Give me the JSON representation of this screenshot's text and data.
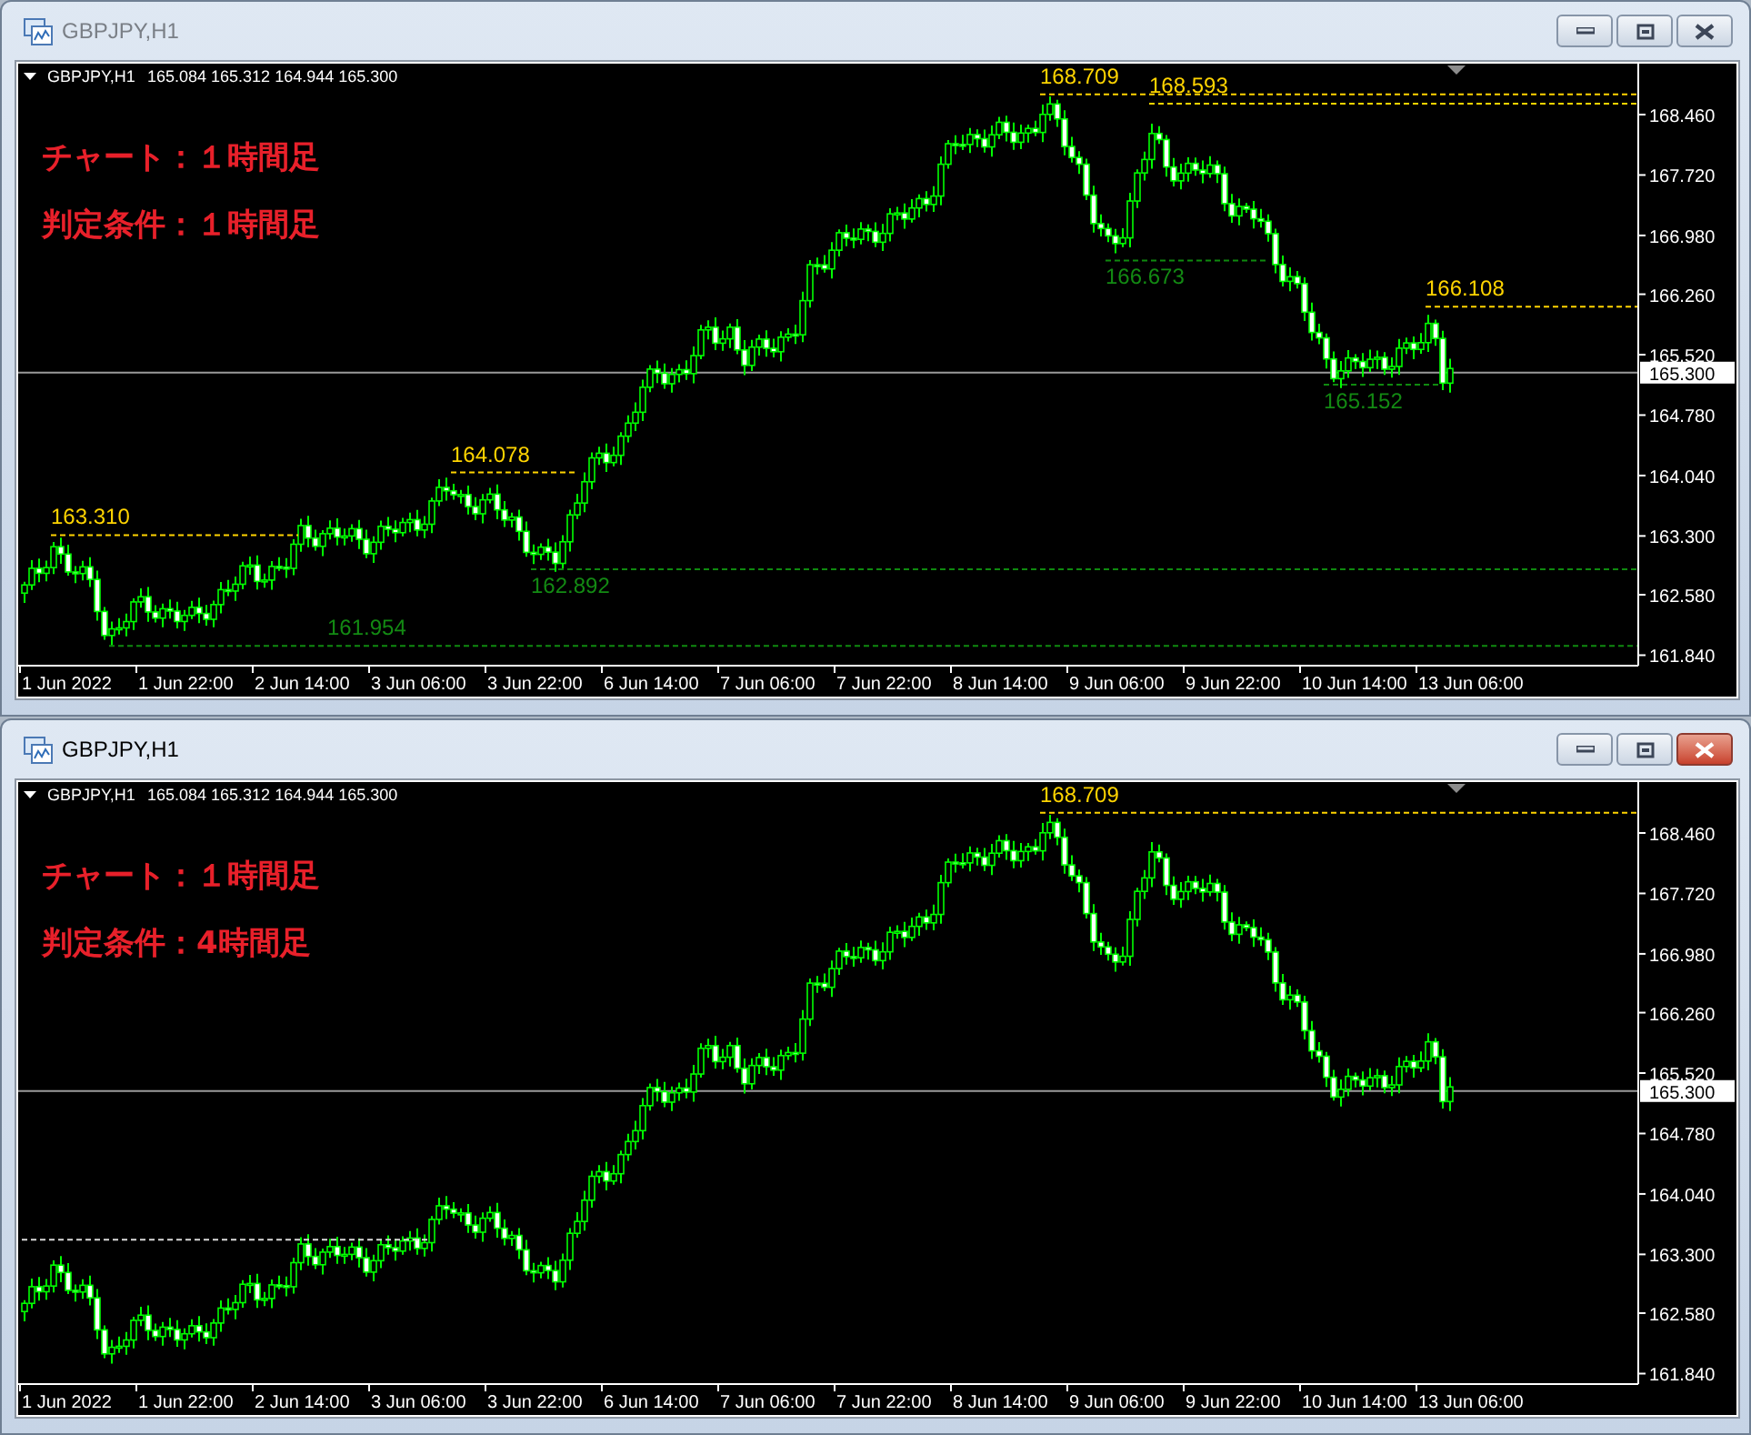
{
  "windows": [
    {
      "title": "GBPJPY,H1",
      "active": false,
      "chart": {
        "symbol": "GBPJPY,H1",
        "quote": "165.084 165.312 164.944 165.300",
        "notes": [
          "チャート：１時間足",
          "判定条件：１時間足"
        ],
        "price_axis": [
          "168.460",
          "167.720",
          "166.980",
          "166.260",
          "165.520",
          "164.780",
          "164.040",
          "163.300",
          "162.580",
          "161.840"
        ],
        "time_axis": [
          "1 Jun 2022",
          "1 Jun 22:00",
          "2 Jun 14:00",
          "3 Jun 06:00",
          "3 Jun 22:00",
          "6 Jun 14:00",
          "7 Jun 06:00",
          "7 Jun 22:00",
          "8 Jun 14:00",
          "9 Jun 06:00",
          "9 Jun 22:00",
          "10 Jun 14:00",
          "13 Jun 06:00"
        ],
        "current_price": "165.300",
        "levels": [
          {
            "kind": "high",
            "label": "168.709"
          },
          {
            "kind": "high",
            "label": "168.593"
          },
          {
            "kind": "low",
            "label": "166.673"
          },
          {
            "kind": "high",
            "label": "166.108"
          },
          {
            "kind": "low",
            "label": "165.152"
          },
          {
            "kind": "high",
            "label": "164.078"
          },
          {
            "kind": "high",
            "label": "163.310"
          },
          {
            "kind": "low",
            "label": "162.892"
          },
          {
            "kind": "low",
            "label": "161.954"
          }
        ]
      }
    },
    {
      "title": "GBPJPY,H1",
      "active": true,
      "chart": {
        "symbol": "GBPJPY,H1",
        "quote": "165.084 165.312 164.944 165.300",
        "notes": [
          "チャート：１時間足",
          "判定条件：4時間足"
        ],
        "price_axis": [
          "168.460",
          "167.720",
          "166.980",
          "166.260",
          "165.520",
          "164.780",
          "164.040",
          "163.300",
          "162.580",
          "161.840"
        ],
        "time_axis": [
          "1 Jun 2022",
          "1 Jun 22:00",
          "2 Jun 14:00",
          "3 Jun 06:00",
          "3 Jun 22:00",
          "6 Jun 14:00",
          "7 Jun 06:00",
          "7 Jun 22:00",
          "8 Jun 14:00",
          "9 Jun 06:00",
          "9 Jun 22:00",
          "10 Jun 14:00",
          "13 Jun 06:00"
        ],
        "current_price": "165.300",
        "levels": [
          {
            "kind": "high",
            "label": "168.709"
          },
          {
            "kind": "guide"
          }
        ]
      }
    }
  ]
}
